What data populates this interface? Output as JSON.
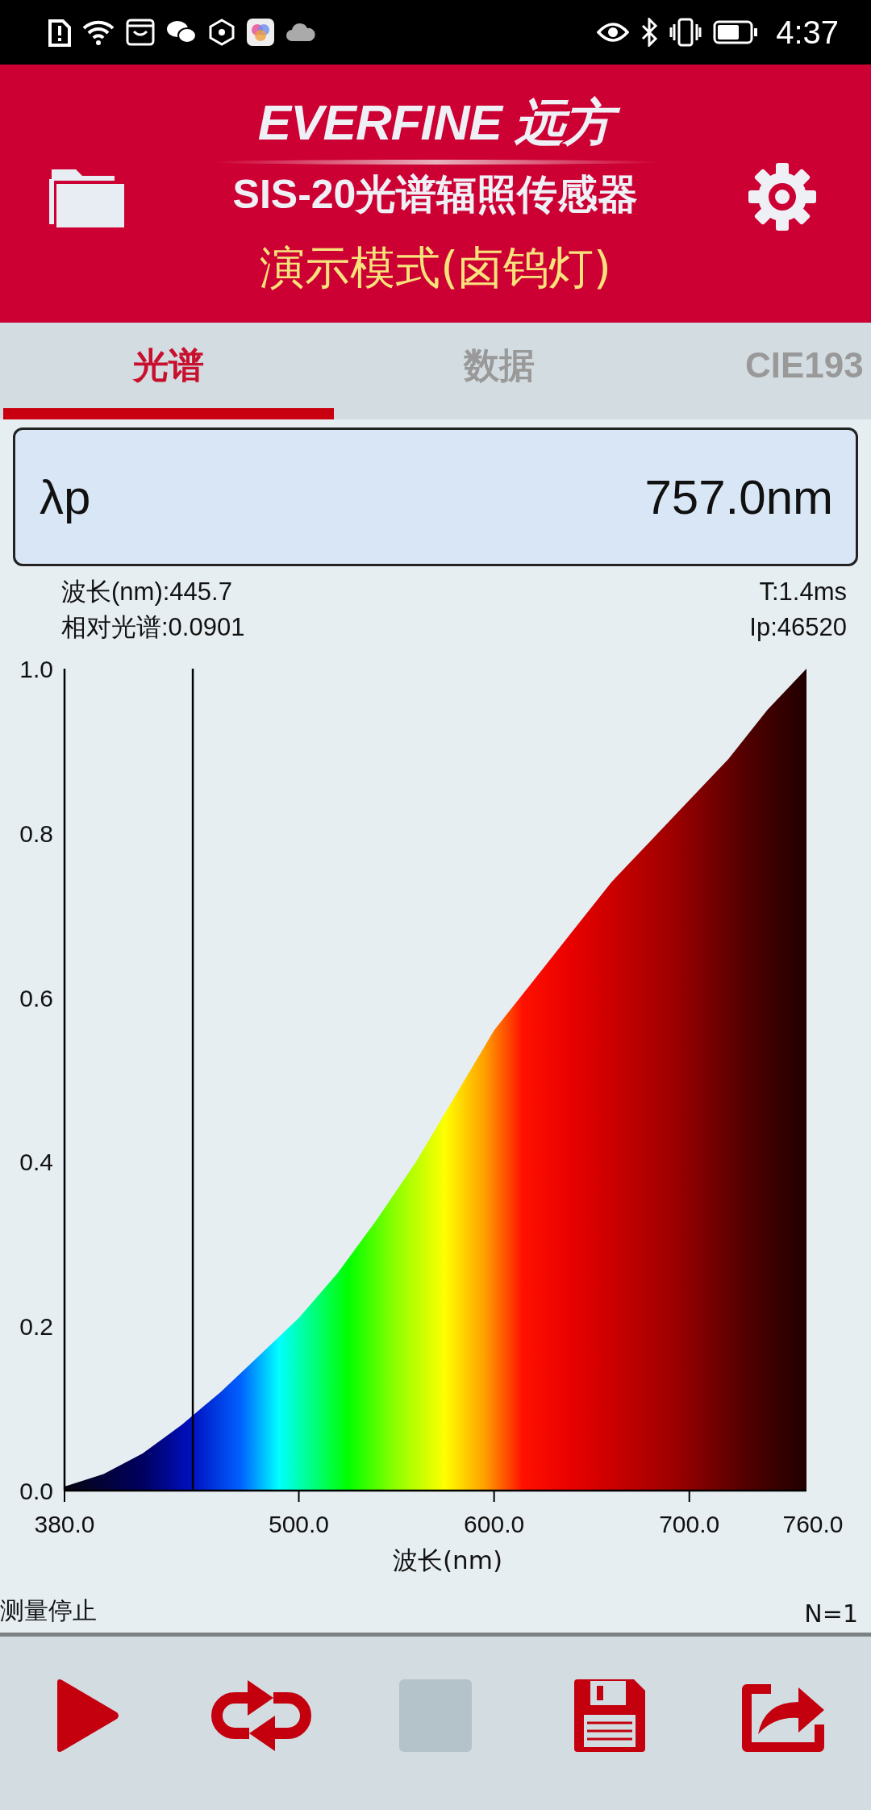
{
  "status_bar": {
    "time": "4:37"
  },
  "header": {
    "brand": "EVERFINE 远方",
    "product": "SIS-20光谱辐照传感器",
    "mode": "演示模式(卤钨灯)"
  },
  "tabs": [
    {
      "label": "光谱",
      "selected": true
    },
    {
      "label": "数据",
      "selected": false
    },
    {
      "label": "CIE193",
      "selected": false
    }
  ],
  "peak": {
    "label": "λp",
    "value": "757.0nm"
  },
  "cursor_info": {
    "wavelength": "波长(nm):445.7",
    "relative": "相对光谱:0.0901",
    "time": "T:1.4ms",
    "ip": "Ip:46520"
  },
  "chart": {
    "chart_data": {
      "type": "area",
      "xlabel": "波长(nm)",
      "x": [
        380,
        400,
        420,
        440,
        460,
        480,
        500,
        520,
        540,
        560,
        580,
        600,
        620,
        640,
        660,
        680,
        700,
        720,
        740,
        760
      ],
      "values": [
        0.005,
        0.02,
        0.045,
        0.08,
        0.12,
        0.165,
        0.21,
        0.265,
        0.33,
        0.4,
        0.48,
        0.56,
        0.62,
        0.68,
        0.74,
        0.79,
        0.84,
        0.89,
        0.95,
        1.0
      ],
      "xlim": [
        380,
        760
      ],
      "ylim": [
        0,
        1
      ],
      "xticks": [
        {
          "value": 380,
          "label": "380.0"
        },
        {
          "value": 500,
          "label": "500.0"
        },
        {
          "value": 600,
          "label": "600.0"
        },
        {
          "value": 700,
          "label": "700.0"
        },
        {
          "value": 760,
          "label": "760.0"
        }
      ],
      "yticks": [
        {
          "value": 0,
          "label": "0.0"
        },
        {
          "value": 0.2,
          "label": "0.2"
        },
        {
          "value": 0.4,
          "label": "0.4"
        },
        {
          "value": 0.6,
          "label": "0.6"
        },
        {
          "value": 0.8,
          "label": "0.8"
        },
        {
          "value": 1,
          "label": "1.0"
        }
      ],
      "ref_lines": [
        {
          "axis": "x",
          "value": 445.7
        }
      ]
    }
  },
  "measure_status": {
    "state": "测量停止",
    "count": "N=1"
  },
  "toolbar": [
    {
      "kind": "play",
      "disabled": false
    },
    {
      "kind": "repeat",
      "disabled": false
    },
    {
      "kind": "stop",
      "disabled": true
    },
    {
      "kind": "save",
      "disabled": false
    },
    {
      "kind": "share",
      "disabled": false
    }
  ]
}
